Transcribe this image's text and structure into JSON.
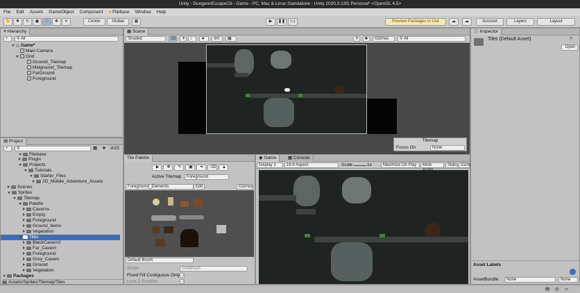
{
  "window": {
    "title": "Unity - DungeonEscapeC6 - Game - PC, Mac & Linux Standalone - Unity 2020.3.12f1 Personal* <OpenGL 4.5>"
  },
  "menu": [
    "File",
    "Edit",
    "Assets",
    "GameObject",
    "Component",
    "Filebase",
    "Window",
    "Help"
  ],
  "toolbar": {
    "pivot": "Center",
    "space": "Global",
    "preview_packages": "Preview Packages in Use",
    "account": "Account",
    "layers": "Layers",
    "layout": "Layout"
  },
  "hierarchy": {
    "tab": "Hierarchy",
    "search_placeholder": "All",
    "scene": "Game*",
    "items": [
      "Main Camera",
      "Grid",
      "Ground_Tilemap",
      "Midground_Tilemap",
      "FarGround",
      "Foreground"
    ]
  },
  "scene": {
    "tab": "Scene",
    "shading": "Shaded",
    "mode2d": "2D",
    "gizmo_count": "0",
    "gizmos": "Gizmos",
    "search_placeholder": "All",
    "overlay_title": "Tilemap",
    "focus_label": "Focus On",
    "focus_value": "None"
  },
  "inspector": {
    "tab": "Inspector",
    "title": "Tiles (Default Asset)",
    "open_button": "Open",
    "asset_labels": "Asset Labels",
    "asset_bundle_label": "AssetBundle",
    "asset_bundle_value": "None",
    "asset_variant_value": "None"
  },
  "project": {
    "tab": "Project",
    "count": "23",
    "items": [
      {
        "label": "Filebase",
        "depth": 1
      },
      {
        "label": "Plugin",
        "depth": 2
      },
      {
        "label": "Projects",
        "depth": 2
      },
      {
        "label": "Tutorials",
        "depth": 3
      },
      {
        "label": "Starter_Files",
        "depth": 4
      },
      {
        "label": "2D_Mobile_Adventure_Assets",
        "depth": 5
      },
      {
        "label": "Scenes",
        "depth": 1
      },
      {
        "label": "Sprites",
        "depth": 1
      },
      {
        "label": "Tilemap",
        "depth": 2
      },
      {
        "label": "Palette",
        "depth": 3
      },
      {
        "label": "Caverns",
        "depth": 4
      },
      {
        "label": "Empty",
        "depth": 4
      },
      {
        "label": "Foreground",
        "depth": 4
      },
      {
        "label": "Ground_Items",
        "depth": 4
      },
      {
        "label": "Vegetation",
        "depth": 4
      },
      {
        "label": "Tiles",
        "depth": 3
      },
      {
        "label": "BlackCavern2",
        "depth": 4
      },
      {
        "label": "Far_Cavern",
        "depth": 4
      },
      {
        "label": "Foreground",
        "depth": 4
      },
      {
        "label": "Grey_Cavern",
        "depth": 4
      },
      {
        "label": "Ground",
        "depth": 4
      },
      {
        "label": "Vegetation",
        "depth": 4
      }
    ],
    "packages": "Packages",
    "path": "Assets/Sprites/Tilemap/Tiles"
  },
  "palette": {
    "tab": "Tile Palette",
    "active_label": "Active Tilemap",
    "active_value": "Foreground",
    "palette_name": "Foreground_Elements",
    "edit": "Edit",
    "gizmos": "Gizmos",
    "brush": "Default Brush",
    "script_label": "Script",
    "script_value": "GridBrush",
    "flood_label": "Flood Fill Contiguous Only",
    "lock_label": "Lock Z Position"
  },
  "game": {
    "tab_game": "Game",
    "tab_console": "Console",
    "display": "Display 1",
    "aspect": "16:9 Aspect",
    "scale_label": "Scale",
    "scale_value": "1x",
    "maximize": "Maximize On Play",
    "mute": "Mute Audio",
    "stats": "Stats",
    "gizmos": "Gizm"
  }
}
